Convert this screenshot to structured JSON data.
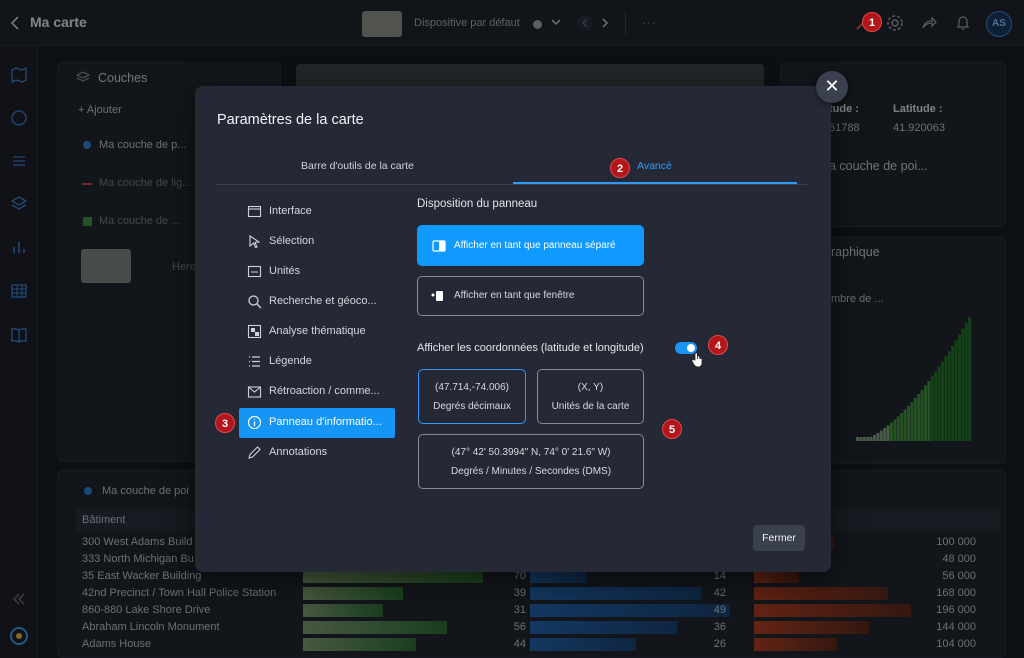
{
  "topbar": {
    "title": "Ma carte",
    "layout_label": "Dispositive par défaut"
  },
  "avatar": "AS",
  "layers": {
    "title": "Couches",
    "add": "+ Ajouter",
    "items": [
      "Ma couche de p...",
      "Ma couche de lig...",
      "Ma couche de ...",
      "Here - Roa..."
    ]
  },
  "info_panel": {
    "lat_label": "Latitude :",
    "lat_value": "41.920063",
    "lon_label_partial": "tude :",
    "lon_value_partial": "51788",
    "layer_partial": "a couche de poi..."
  },
  "chart_panel": {
    "title_partial": "raphique",
    "dropdown_partial": "mbre de ..."
  },
  "table": {
    "layer": "Ma couche de poi",
    "header": "Bâtiment",
    "rows": [
      {
        "name": "300 West Adams Build",
        "a": "",
        "b": "",
        "c": "100 000"
      },
      {
        "name": "333 North Michigan Bu",
        "a": "",
        "b": "",
        "c": "48 000"
      },
      {
        "name": "35 East Wacker Building",
        "a": "70",
        "b": "14",
        "c": "56 000"
      },
      {
        "name": "42nd Precinct / Town Hall Police Station",
        "a": "39",
        "b": "42",
        "c": "168 000"
      },
      {
        "name": "860-880 Lake Shore Drive",
        "a": "31",
        "b": "49",
        "c": "196 000"
      },
      {
        "name": "Abraham Lincoln Monument",
        "a": "56",
        "b": "36",
        "c": "144 000"
      },
      {
        "name": "Adams House",
        "a": "44",
        "b": "26",
        "c": "104 000"
      }
    ]
  },
  "dialog": {
    "title": "Paramètres de la carte",
    "tabs": [
      "Barre d'outils de la carte",
      "Avancé"
    ],
    "menu": [
      {
        "label": "Interface",
        "icon": "window-icon"
      },
      {
        "label": "Sélection",
        "icon": "cursor-icon"
      },
      {
        "label": "Unités",
        "icon": "ruler-icon"
      },
      {
        "label": "Recherche et géoco...",
        "icon": "search-icon"
      },
      {
        "label": "Analyse thématique",
        "icon": "thematic-icon"
      },
      {
        "label": "Légende",
        "icon": "legend-icon"
      },
      {
        "label": "Rétroaction / comme...",
        "icon": "feedback-icon"
      },
      {
        "label": "Panneau d'informatio...",
        "icon": "info-icon"
      },
      {
        "label": "Annotations",
        "icon": "pen-icon"
      }
    ],
    "panel_layout_label": "Disposition du panneau",
    "opt_separate": "Afficher en tant que panneau séparé",
    "opt_window": "Afficher en tant que fenêtre",
    "coords_label": "Afficher les coordonnées (latitude et longitude)",
    "coords_enabled": true,
    "fmt_decimal_value": "(47.714,-74.006)",
    "fmt_decimal_label": "Degrés décimaux",
    "fmt_map_value": "(X, Y)",
    "fmt_map_label": "Unités de la carte",
    "fmt_dms_value": "(47° 42' 50.3994\" N, 74° 0' 21.6\" W)",
    "fmt_dms_label": "Degrés / Minutes / Secondes (DMS)",
    "close_label": "Fermer"
  },
  "badges": [
    "1",
    "2",
    "3",
    "4",
    "5"
  ],
  "colors": {
    "accent": "#109aff",
    "badge": "#b3161a",
    "dialog_bg": "#242935"
  }
}
